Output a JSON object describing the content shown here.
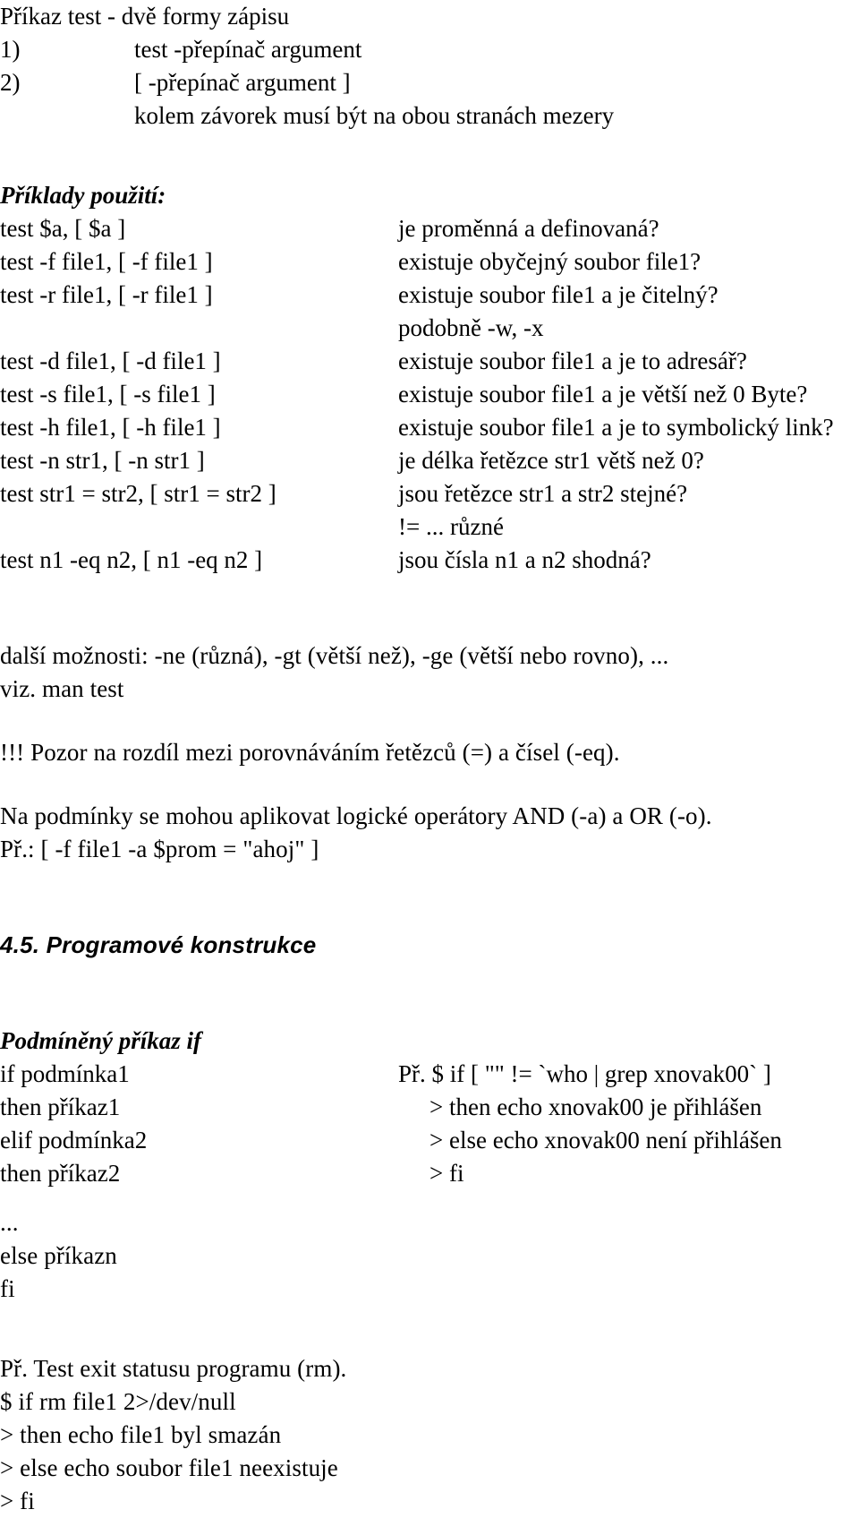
{
  "document": {
    "section_title": "Příkaz test - dvě formy zápisu",
    "syntax_forms": [
      {
        "num": "1)",
        "text": "test -přepínač argument"
      },
      {
        "num": "2)",
        "text": "[ -přepínač argument ]"
      }
    ],
    "syntax_note": "kolem závorek musí být na obou stranách mezery",
    "examples_heading": "Příklady použití:",
    "examples": [
      {
        "command": "test $a, [ $a ]",
        "meaning": "je proměnná a definovaná?"
      },
      {
        "command": "test -f file1, [ -f file1 ]",
        "meaning": "existuje obyčejný soubor file1?"
      },
      {
        "command": "test -r file1, [ -r file1 ]",
        "meaning": "existuje soubor file1 a je čitelný?"
      },
      {
        "command": "",
        "meaning": "podobně -w, -x"
      },
      {
        "command": "test -d file1, [ -d file1 ]",
        "meaning": "existuje soubor file1 a je to adresář?"
      },
      {
        "command": "test -s file1, [ -s file1 ]",
        "meaning": "existuje soubor file1 a je větší než 0 Byte?"
      },
      {
        "command": "test -h file1, [ -h file1 ]",
        "meaning": "existuje soubor file1 a je to symbolický link?"
      },
      {
        "command": "test -n str1, [ -n str1 ]",
        "meaning": "je délka řetězce str1 větš než 0?"
      },
      {
        "command": "test str1 = str2, [ str1 = str2 ]",
        "meaning": "jsou řetězce str1 a str2 stejné?"
      },
      {
        "command": "",
        "meaning": "!= ... různé"
      },
      {
        "command": "test n1 -eq n2, [ n1 -eq n2 ]",
        "meaning": "jsou čísla n1 a n2 shodná?"
      }
    ],
    "more_options": [
      "další možnosti: -ne (různá), -gt (větší než), -ge (větší nebo rovno), ...",
      "viz. man test"
    ],
    "warning": "!!! Pozor na rozdíl mezi porovnáváním řetězců (=) a čísel (-eq).",
    "logic_operators": [
      "Na podmínky se mohou aplikovat logické operátory AND (-a) a OR (-o).",
      "Př.: [ -f file1 -a $prom = \"ahoj\" ]"
    ],
    "chapter_heading": "4.5. Programové konstrukce",
    "if_heading": "Podmíněný příkaz if",
    "if_syntax": [
      "if podmínka1",
      "then příkaz1",
      "elif podmínka2",
      "then příkaz2"
    ],
    "if_syntax_tail": [
      "...",
      "else příkazn",
      "fi"
    ],
    "if_example": [
      "Př. $ if [ \"\" != `who | grep xnovak00` ]",
      "> then echo xnovak00 je přihlášen",
      "> else echo xnovak00 není přihlášen",
      "> fi"
    ],
    "exit_status_example": [
      "Př. Test exit statusu programu (rm).",
      "$ if rm file1 2>/dev/null",
      "> then echo file1 byl smazán",
      "> else echo soubor file1 neexistuje",
      "> fi"
    ]
  }
}
